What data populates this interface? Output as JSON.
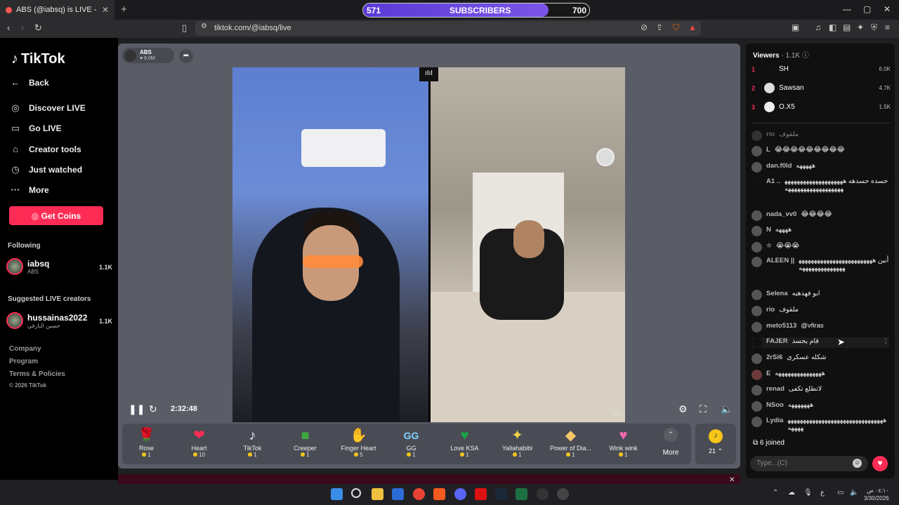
{
  "browser": {
    "tab_title": "ABS (@iabsq) is LIVE - TikTok",
    "tab_close": "✕",
    "new_tab": "+",
    "url": "tiktok.com/@iabsq/live",
    "window_controls": [
      "—",
      "▢",
      "✕"
    ]
  },
  "subscriber_bar": {
    "current": "571",
    "label": "SUBSCRIBERS",
    "goal": "700",
    "progress": 0.82
  },
  "sidebar": {
    "logo": "TikTok",
    "nav": [
      {
        "label": "Back",
        "icon": "back-arrow-icon"
      },
      {
        "label": "Discover LIVE",
        "icon": "live-icon"
      },
      {
        "label": "Go LIVE",
        "icon": "camera-icon"
      },
      {
        "label": "Creator tools",
        "icon": "home-icon"
      },
      {
        "label": "Just watched",
        "icon": "history-icon"
      },
      {
        "label": "More",
        "icon": "more-icon"
      }
    ],
    "get_coins": "Get Coins",
    "following_title": "Following",
    "following": [
      {
        "name": "iabsq",
        "sub": "ABS",
        "count": "1.1K"
      }
    ],
    "suggested_title": "Suggested LIVE creators",
    "suggested": [
      {
        "name": "hussainas2022",
        "sub": "حسين البارقي",
        "count": "1.1K"
      }
    ],
    "footer": [
      "Company",
      "Program",
      "Terms & Policies",
      "© 2026 TikTok"
    ]
  },
  "stream": {
    "host_name": "ABS",
    "host_likes": "6.0M",
    "elapsed": "2:32:48",
    "corner_tag": "ER"
  },
  "gifts": [
    {
      "name": "Rose",
      "cost": "1",
      "glyph": "🌹"
    },
    {
      "name": "Heart",
      "cost": "10",
      "glyph": "❤"
    },
    {
      "name": "TikTok",
      "cost": "1",
      "glyph": "♪"
    },
    {
      "name": "Creeper",
      "cost": "1",
      "glyph": "■"
    },
    {
      "name": "Finger Heart",
      "cost": "5",
      "glyph": "✋"
    },
    {
      "name": "GG",
      "cost": "1",
      "glyph": "GG"
    },
    {
      "name": "Love KSA",
      "cost": "1",
      "glyph": "♥"
    },
    {
      "name": "Yallahabibi",
      "cost": "1",
      "glyph": "✦"
    },
    {
      "name": "Power of Dia...",
      "cost": "1",
      "glyph": "◆"
    },
    {
      "name": "Wink wink",
      "cost": "1",
      "glyph": "♥"
    }
  ],
  "gift_more": "More",
  "coin_count": "21",
  "viewers": {
    "title": "Viewers",
    "count": "· 1.1K",
    "top": [
      {
        "rank": "1",
        "name": "SH",
        "score": "6.0K"
      },
      {
        "rank": "2",
        "name": "Sawsan",
        "score": "4.7K"
      },
      {
        "rank": "3",
        "name": "O.X5",
        "score": "1.5K"
      }
    ]
  },
  "chat": [
    {
      "user": "rio",
      "text": "ملقوف"
    },
    {
      "user": "L",
      "text": "😂😂😂😂😂😂😂😂😂"
    },
    {
      "user": "dan.f0ld",
      "text": "هههههه"
    },
    {
      "user": "A1 ..",
      "text": "حسده حسدهه ههههههههههههههههههههههههههههههههههههههه"
    },
    {
      "user": "nada_vv0",
      "text": "😂😂😂😂"
    },
    {
      "user": "N",
      "text": "ههههه"
    },
    {
      "user": "✮",
      "text": "😭😭😭"
    },
    {
      "user": "ALEEN ||",
      "text": "أنين هههههههههههههههههههههههههههههههههههههههه"
    },
    {
      "user": "Selena",
      "text": "ابو فهدهيه"
    },
    {
      "user": "rio",
      "text": "ملقوف"
    },
    {
      "user": "meto5113",
      "text": "@vfiras"
    },
    {
      "user": "FAJER",
      "text": "قام يحسد"
    },
    {
      "user": "2rSi6",
      "text": "شكله عسكري"
    },
    {
      "user": "E",
      "text": "هههههههههههههههه"
    },
    {
      "user": "renad",
      "text": "لاتطلع تكفى"
    },
    {
      "user": "NSoo",
      "text": "هههههههه"
    },
    {
      "user": "Lydia",
      "text": "ههههههههههههههههههههههههههههههههههههه"
    }
  ],
  "joined": "6  joined",
  "chat_placeholder": "Type...(C)",
  "taskbar": {
    "time": "٠٤:١٠ ص",
    "date": "3/30/2026"
  }
}
